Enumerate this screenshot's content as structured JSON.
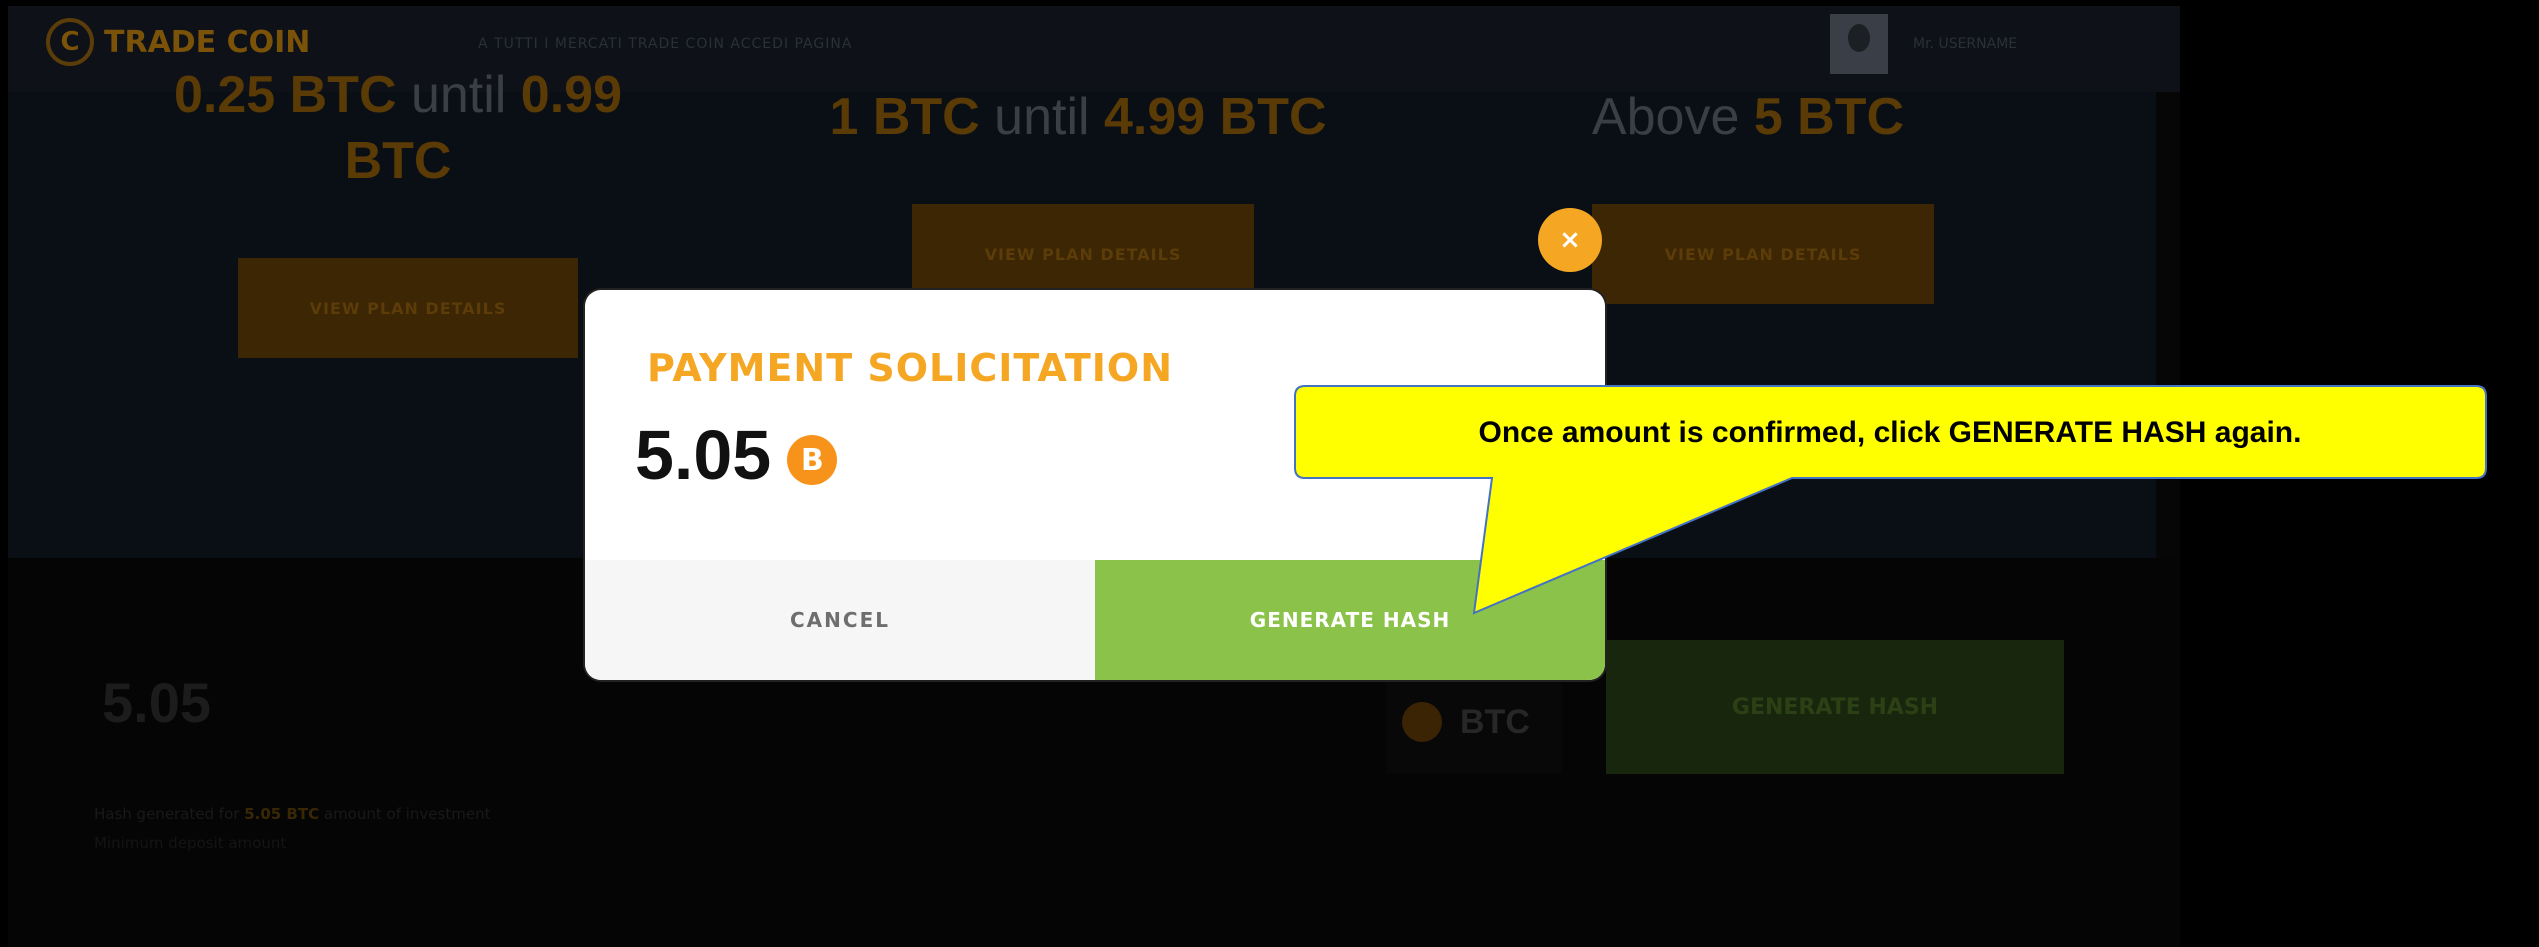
{
  "brand": {
    "logo_letter": "C",
    "name": "TRADE COIN"
  },
  "header": {
    "nav_text": "A TUTTI I MERCATI TRADE COIN ACCEDI PAGINA",
    "user_text": "Mr. USERNAME"
  },
  "plans": [
    {
      "from": "0.25 BTC",
      "mid": " until ",
      "to": "0.99 BTC",
      "button": "VIEW PLAN DETAILS"
    },
    {
      "from": "1 BTC",
      "mid": " until ",
      "to": "4.99 BTC",
      "button": "VIEW PLAN DETAILS"
    },
    {
      "from": "",
      "mid": "Above ",
      "to": "5 BTC",
      "button": "VIEW PLAN DETAILS"
    }
  ],
  "form": {
    "amount": "5.05",
    "currency": "BTC",
    "generate_label": "GENERATE HASH",
    "note_prefix": "Hash generated for ",
    "note_amount": "5.05 BTC",
    "note_suffix": " amount of investment",
    "note_line2": "Minimum deposit amount"
  },
  "modal": {
    "close_symbol": "×",
    "title": "PAYMENT SOLICITATION",
    "amount": "5.05",
    "btc_symbol": "B",
    "cancel_label": "CANCEL",
    "generate_label": "GENERATE HASH"
  },
  "callout": {
    "text": "Once amount is confirmed, click GENERATE HASH again.",
    "fill": "#ffff00",
    "stroke": "#4472c4"
  },
  "colors": {
    "accent": "#f5a623",
    "green": "#8bc34a",
    "btc": "#f7931a"
  }
}
